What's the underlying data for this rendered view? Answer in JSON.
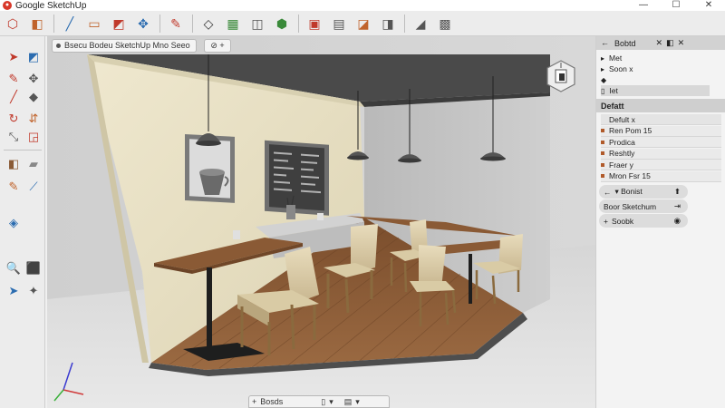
{
  "window": {
    "title": "Google SketchUp",
    "controls": [
      "—",
      "☐",
      "✕"
    ]
  },
  "toolbar": {
    "tools": [
      {
        "name": "select-tool",
        "glyph": "⬡"
      },
      {
        "name": "component-tool",
        "glyph": "◧"
      },
      {
        "name": "line-tool",
        "glyph": "╱"
      },
      {
        "name": "eraser-tool",
        "glyph": "▭"
      },
      {
        "name": "rectangle-tool",
        "glyph": "◩"
      },
      {
        "name": "move-tool",
        "glyph": "✥"
      },
      {
        "name": "pencil-tool",
        "glyph": "✎"
      },
      {
        "name": "paint-bucket-tool",
        "glyph": "◇"
      },
      {
        "name": "grid-tool",
        "glyph": "▦"
      },
      {
        "name": "push-pull-tool",
        "glyph": "◫"
      },
      {
        "name": "rotate-tool",
        "glyph": "⬢"
      },
      {
        "name": "follow-me-tool",
        "glyph": "▣"
      },
      {
        "name": "tape-tool",
        "glyph": "▤"
      },
      {
        "name": "dimension-tool",
        "glyph": "◪"
      },
      {
        "name": "orbit-tool",
        "glyph": "◨"
      },
      {
        "name": "section-tool",
        "glyph": "◢"
      },
      {
        "name": "camera-tool",
        "glyph": "▩"
      }
    ]
  },
  "leftpalette": {
    "tools": [
      {
        "name": "select-arrow-tool",
        "glyph": "➤"
      },
      {
        "name": "eraser-palette-tool",
        "glyph": "◩"
      },
      {
        "name": "pencil-palette-tool",
        "glyph": "✎"
      },
      {
        "name": "move-palette-tool",
        "glyph": "✥"
      },
      {
        "name": "line-palette-tool",
        "glyph": "╱"
      },
      {
        "name": "shape-palette-tool",
        "glyph": "◆"
      },
      {
        "name": "rotate-palette-tool",
        "glyph": "↻"
      },
      {
        "name": "flip-palette-tool",
        "glyph": "⇵"
      },
      {
        "name": "scale-palette-tool",
        "glyph": "⤡"
      },
      {
        "name": "offset-palette-tool",
        "glyph": "◲"
      },
      {
        "name": "paint-palette-tool",
        "glyph": "◧"
      },
      {
        "name": "tape-palette-tool",
        "glyph": "▰"
      },
      {
        "name": "text-palette-tool",
        "glyph": "✎"
      },
      {
        "name": "axes-palette-tool",
        "glyph": "⟋"
      },
      {
        "name": "protractor-palette-tool",
        "glyph": "◈"
      },
      {
        "name": "zoom-palette-tool",
        "glyph": "🔍"
      },
      {
        "name": "box-palette-tool",
        "glyph": "⬛"
      },
      {
        "name": "walk-palette-tool",
        "glyph": "➤"
      },
      {
        "name": "look-palette-tool",
        "glyph": "✦"
      }
    ]
  },
  "viewport": {
    "scene_tab": "Bsecu Bodeu SketchUp Mno Seeo",
    "scene_add": "⊘ +",
    "bottom_bar": {
      "add": "+",
      "label": "Bosds",
      "icons": [
        "▯",
        "▾",
        "▤",
        "▾"
      ]
    }
  },
  "rightpanel": {
    "outliner": {
      "title": "Bobtd",
      "title_icons": [
        "✕",
        "◧",
        "✕"
      ],
      "items": [
        {
          "label": "Met",
          "icon": "▸"
        },
        {
          "label": "Soon x",
          "icon": "▸"
        },
        {
          "label": "",
          "icon": "◆"
        },
        {
          "label": "Iet",
          "icon": "▯"
        }
      ]
    },
    "materials": {
      "title": "Defatt",
      "items": [
        {
          "label": "Defult x"
        },
        {
          "label": "Ren Pom 15"
        },
        {
          "label": "Prodica"
        },
        {
          "label": "Reshtly"
        },
        {
          "label": "Fraer y"
        },
        {
          "label": "Mron Fsr 15"
        }
      ]
    },
    "pills": [
      {
        "label": "▾ Bonist",
        "icon": "⬆"
      },
      {
        "label": "Boor Sketchum",
        "icon": "⇥"
      },
      {
        "label": "Soobk",
        "icon": "◉"
      }
    ]
  },
  "colors": {
    "brand": "#d8382a",
    "chrome": "#ececec",
    "panel_header": "#d2d2d2",
    "wall_cream": "#e9e2c6",
    "floor_wood": "#8a5a35",
    "ceiling": "#4a4a4a"
  }
}
